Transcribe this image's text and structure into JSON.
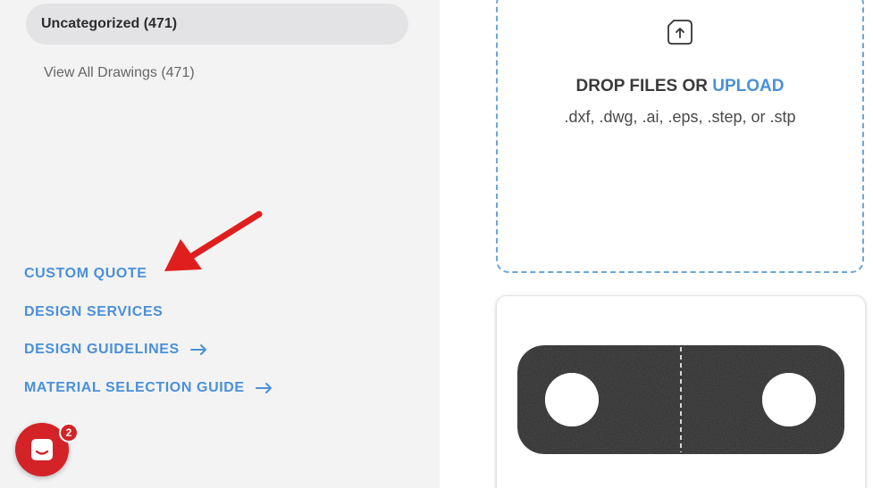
{
  "sidebar": {
    "category_active": "Uncategorized (471)",
    "view_all": "View All Drawings (471)",
    "links": {
      "custom_quote": "CUSTOM QUOTE",
      "design_services": "DESIGN SERVICES",
      "design_guidelines": "DESIGN GUIDELINES",
      "material_guide": "MATERIAL SELECTION GUIDE"
    }
  },
  "chat": {
    "badge_count": "2",
    "icon": "chat-icon"
  },
  "upload": {
    "title_prefix": "DROP FILES OR",
    "title_link": "UPLOAD",
    "formats": ".dxf, .dwg, .ai, .eps, .step, or .stp",
    "icon": "file-upload-icon"
  },
  "colors": {
    "accent": "#4a90d9",
    "annotation_red": "#e01e1e",
    "chat_red": "#d32327",
    "sidebar_bg": "#f3f3f3",
    "part_material": "#2b2b2b"
  }
}
